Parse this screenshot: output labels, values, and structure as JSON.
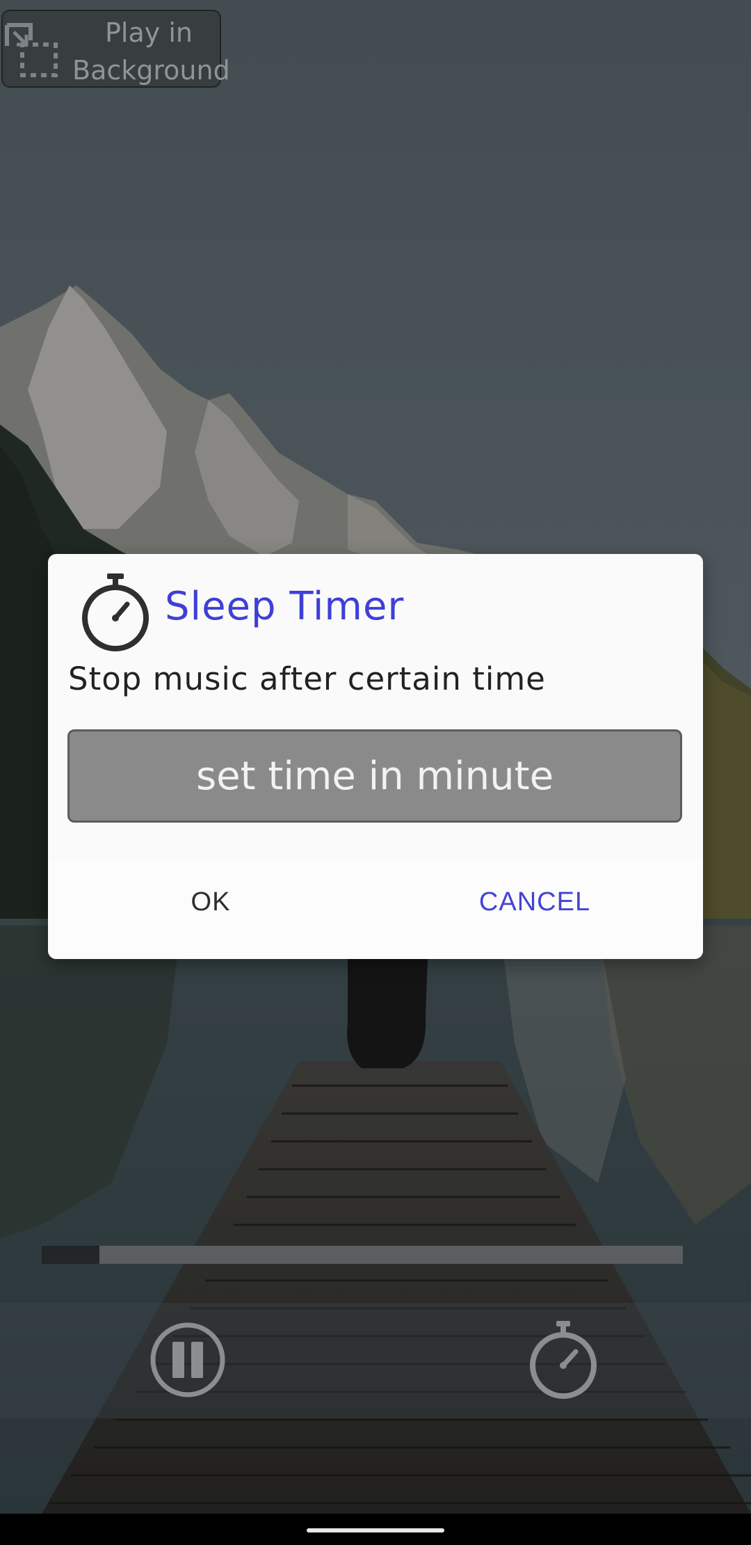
{
  "background_chip": {
    "label": "Play in\nBackground",
    "icon": "picture-in-picture-icon"
  },
  "player": {
    "progress_fraction": 0.09,
    "pause_icon": "pause-circle-icon",
    "timer_icon": "stopwatch-icon"
  },
  "dialog": {
    "icon": "stopwatch-icon",
    "title": "Sleep Timer",
    "message": "Stop music after certain time",
    "input_value": "",
    "input_placeholder": "set time in minute",
    "ok_label": "OK",
    "cancel_label": "CANCEL"
  },
  "colors": {
    "accent": "#3f3fd8",
    "button_accent": "#4343d6",
    "input_bg": "#8a8a8a",
    "dialog_bg": "#fafafa"
  }
}
